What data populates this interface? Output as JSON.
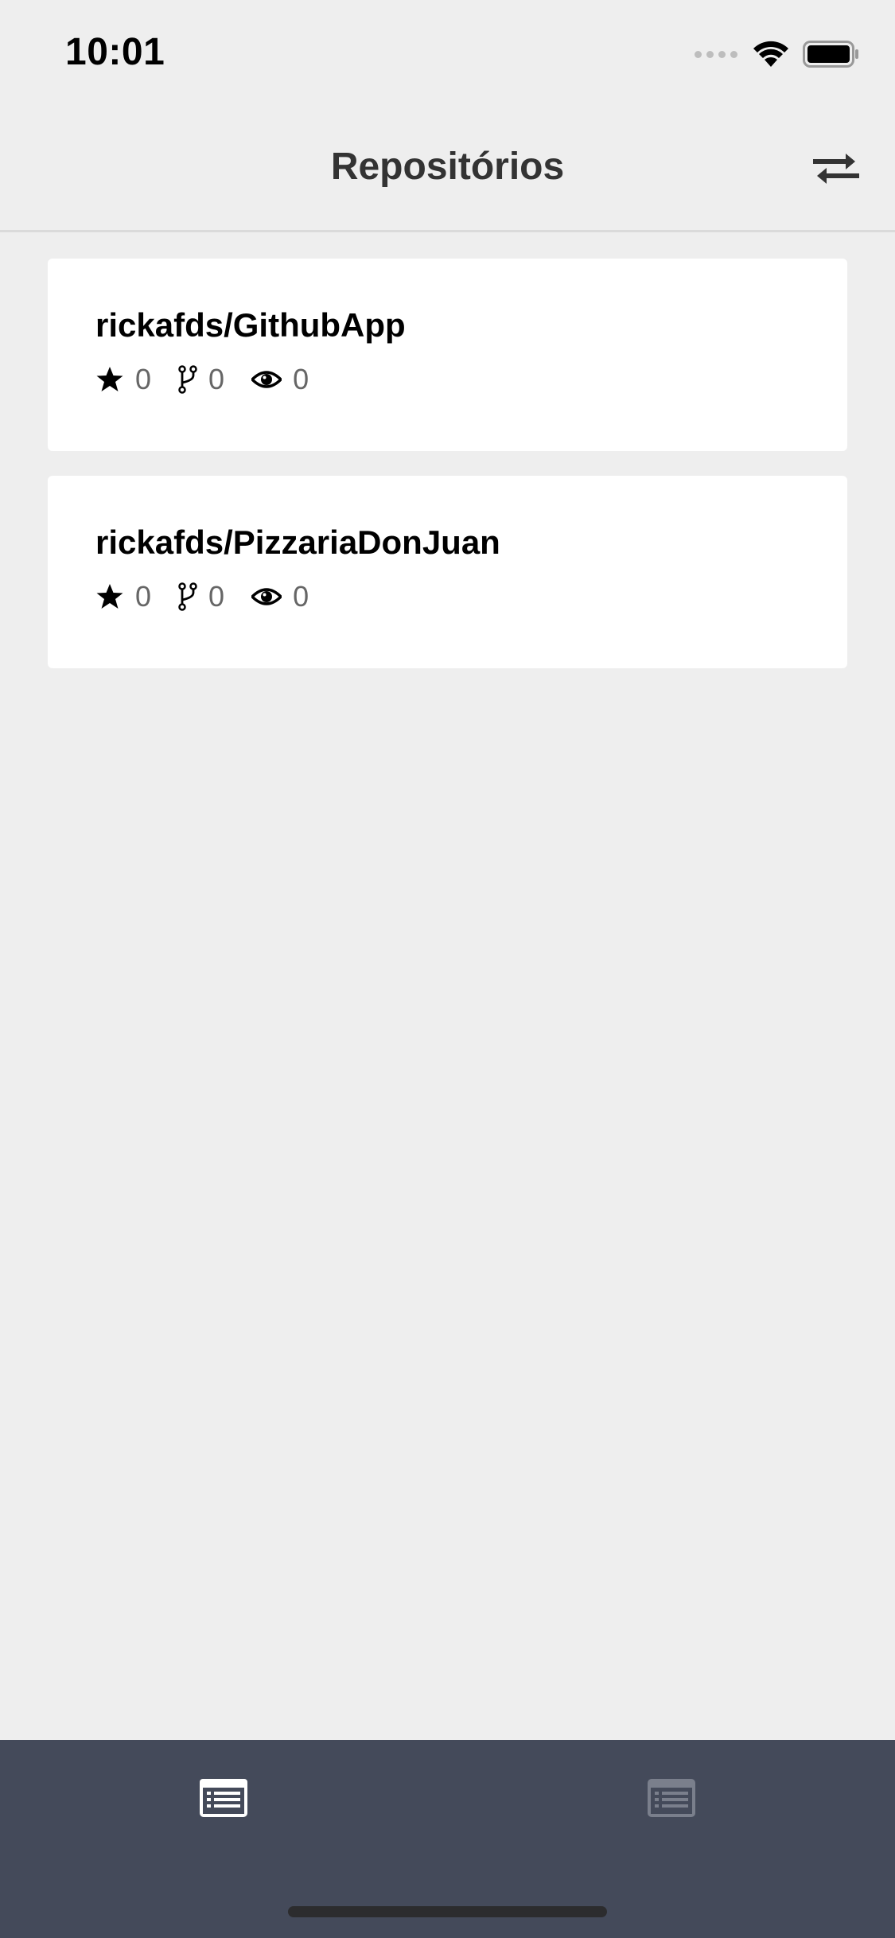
{
  "status_bar": {
    "time": "10:01"
  },
  "nav": {
    "title": "Repositórios",
    "action_icon": "swap-icon"
  },
  "repositories": [
    {
      "name": "rickafds/GithubApp",
      "stars": "0",
      "forks": "0",
      "watchers": "0"
    },
    {
      "name": "rickafds/PizzariaDonJuan",
      "stars": "0",
      "forks": "0",
      "watchers": "0"
    }
  ],
  "tab_bar": {
    "tabs": [
      {
        "icon": "list-icon",
        "active": true
      },
      {
        "icon": "list-icon",
        "active": false
      }
    ],
    "active_color": "#FFFFFF",
    "inactive_color": "#7A7F8C",
    "background": "#444A5A"
  },
  "colors": {
    "background": "#EEEEEE",
    "card": "#FFFFFF",
    "title_text": "#333333",
    "stat_text": "#666666"
  }
}
